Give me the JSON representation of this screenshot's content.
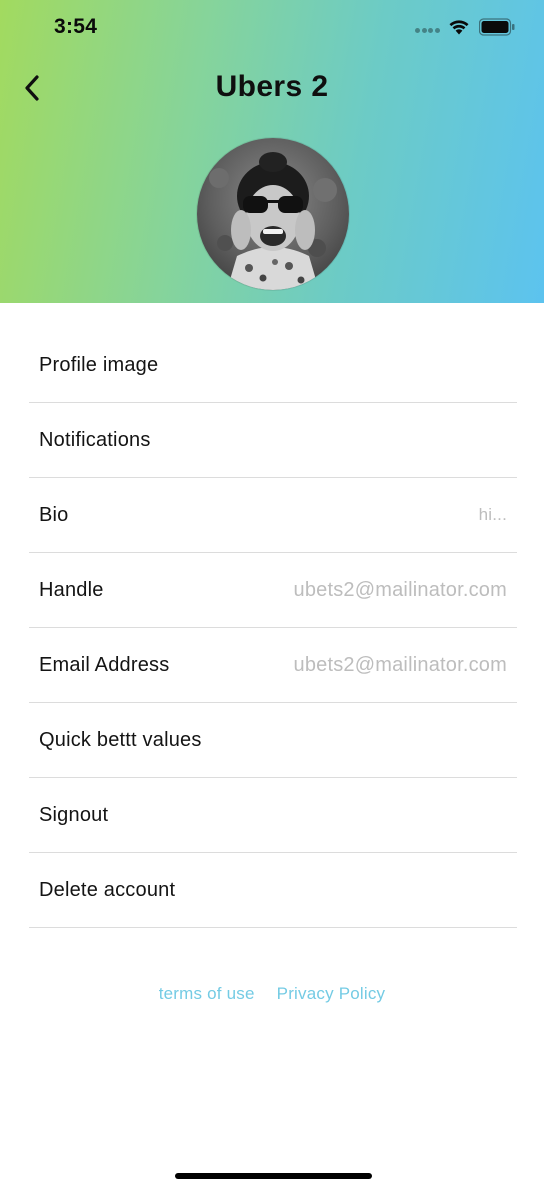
{
  "status_bar": {
    "time": "3:54"
  },
  "nav": {
    "title": "Ubers 2"
  },
  "settings": {
    "items": [
      {
        "label": "Profile image",
        "value": ""
      },
      {
        "label": "Notifications",
        "value": ""
      },
      {
        "label": "Bio",
        "value": "hi..."
      },
      {
        "label": "Handle",
        "value": "ubets2@mailinator.com"
      },
      {
        "label": "Email Address",
        "value": "ubets2@mailinator.com"
      },
      {
        "label": "Quick bettt values",
        "value": ""
      },
      {
        "label": "Signout",
        "value": ""
      },
      {
        "label": "Delete account",
        "value": ""
      }
    ]
  },
  "footer": {
    "terms_label": "terms of use",
    "privacy_label": "Privacy Policy"
  },
  "colors": {
    "gradient_start": "#a2da5f",
    "gradient_end": "#5cc3ef",
    "link": "#74cbe4",
    "value_text": "#bdbdbd"
  },
  "icons": {
    "back": "chevron-left-icon",
    "wifi": "wifi-icon",
    "battery": "battery-icon"
  }
}
